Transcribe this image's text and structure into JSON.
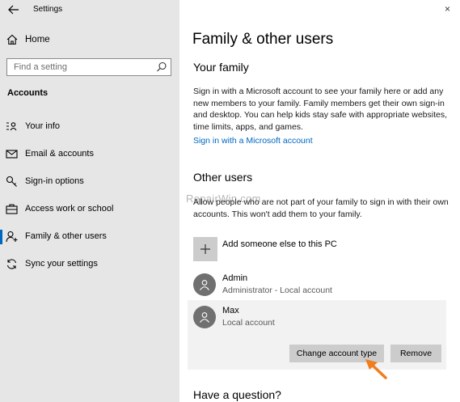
{
  "window": {
    "title": "Settings",
    "close_glyph": "×"
  },
  "sidebar": {
    "home_label": "Home",
    "search_placeholder": "Find a setting",
    "section_heading": "Accounts",
    "items": [
      {
        "label": "Your info",
        "icon": "contact-card-icon"
      },
      {
        "label": "Email & accounts",
        "icon": "mail-icon"
      },
      {
        "label": "Sign-in options",
        "icon": "key-icon"
      },
      {
        "label": "Access work or school",
        "icon": "briefcase-icon"
      },
      {
        "label": "Family & other users",
        "icon": "person-add-icon",
        "selected": true
      },
      {
        "label": "Sync your settings",
        "icon": "sync-icon"
      }
    ]
  },
  "main": {
    "title": "Family & other users",
    "your_family": {
      "heading": "Your family",
      "description": "Sign in with a Microsoft account to see your family here or add any new members to your family. Family members get their own sign-in and desktop. You can help kids stay safe with appropriate websites, time limits, apps, and games.",
      "link": "Sign in with a Microsoft account"
    },
    "other_users": {
      "heading": "Other users",
      "description": "Allow people who are not part of your family to sign in with their own accounts. This won't add them to your family.",
      "add_label": "Add someone else to this PC",
      "users": [
        {
          "name": "Admin",
          "sub": "Administrator - Local account"
        },
        {
          "name": "Max",
          "sub": "Local account"
        }
      ],
      "change_button": "Change account type",
      "remove_button": "Remove"
    },
    "question_heading": "Have a question?"
  },
  "watermark": "RepairWin.com",
  "colors": {
    "accent": "#0067c0",
    "arrow": "#f07d1e"
  }
}
